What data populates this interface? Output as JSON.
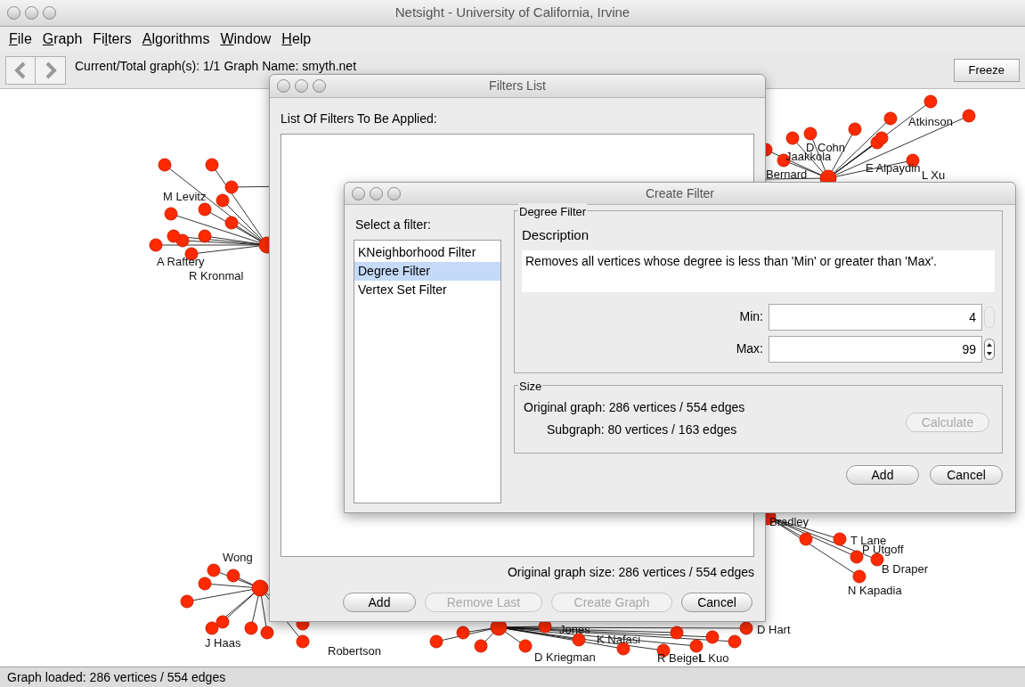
{
  "window": {
    "title": "Netsight - University of California, Irvine"
  },
  "menu": [
    {
      "underlined": "F",
      "rest": "ile"
    },
    {
      "underlined": "G",
      "rest": "raph"
    },
    {
      "lead": "Fi",
      "underlined": "l",
      "rest": "ters"
    },
    {
      "underlined": "A",
      "rest": "lgorithms"
    },
    {
      "underlined": "W",
      "rest": "indow"
    },
    {
      "underlined": "H",
      "rest": "elp"
    }
  ],
  "toolbar": {
    "graph_count": "Current/Total graph(s): 1/1",
    "graph_name": "Graph Name: smyth.net",
    "freeze_button": "Freeze"
  },
  "graph": {
    "node_labels": [
      "M Levitz",
      "A Raftery",
      "R Kronmal",
      "Atkinson",
      "D Cohn",
      "Jaakkola",
      "E Alpaydin",
      "Bernard",
      "L Xu",
      "T Lane",
      "P Utgoff",
      "B Draper",
      "N Kapadia",
      "Bradley",
      "J Haas",
      "Robertson",
      "Wong",
      "Jones",
      "K Nafasi",
      "D Kriegman",
      "R Beigel",
      "L Kuo",
      "D Hart"
    ]
  },
  "filters_list": {
    "title": "Filters List",
    "list_label": "List Of Filters To Be Applied:",
    "size_text": "Original graph size: 286 vertices / 554 edges",
    "buttons": [
      {
        "label": "Add",
        "disabled": false
      },
      {
        "label": "Remove Last",
        "disabled": true
      },
      {
        "label": "Create Graph",
        "disabled": true
      },
      {
        "label": "Cancel",
        "disabled": false
      }
    ]
  },
  "create_filter": {
    "title": "Create Filter",
    "select_label": "Select a filter:",
    "filters": [
      {
        "label": "KNeighborhood Filter",
        "selected": false
      },
      {
        "label": "Degree Filter",
        "selected": true
      },
      {
        "label": "Vertex Set Filter",
        "selected": false
      }
    ],
    "group_title": "Degree Filter",
    "description_label": "Description",
    "description": "Removes all vertices whose degree is less than 'Min' or greater than 'Max'.",
    "fields": [
      {
        "label": "Min:",
        "value": "4",
        "disabled": true
      },
      {
        "label": "Max:",
        "value": "99",
        "disabled": false
      }
    ],
    "size_title": "Size",
    "original": "Original graph: 286 vertices / 554 edges",
    "subgraph": "Subgraph: 80 vertices / 163 edges",
    "calculate_button": {
      "label": "Calculate",
      "disabled": true
    },
    "buttons": [
      "Add",
      "Cancel"
    ]
  },
  "status_bar": "Graph loaded: 286 vertices / 554 edges"
}
